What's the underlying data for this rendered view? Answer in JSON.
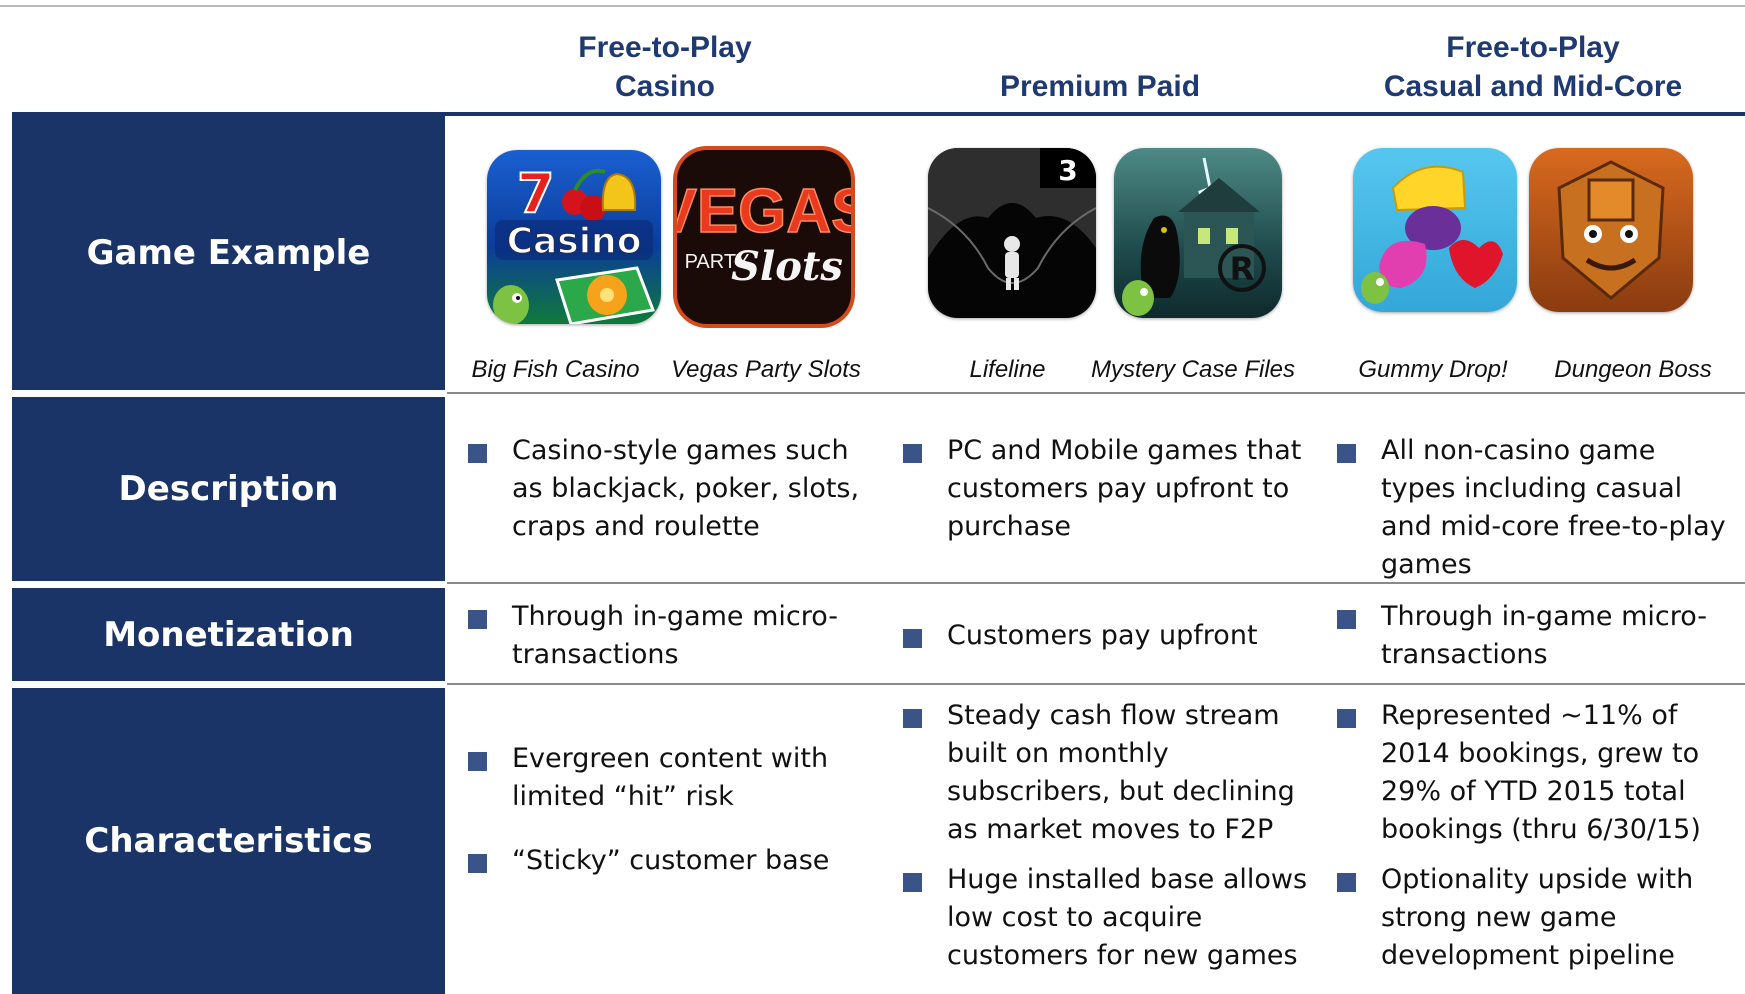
{
  "columns": [
    {
      "line1": "Free-to-Play",
      "line2": "Casino"
    },
    {
      "line1": "",
      "line2": "Premium Paid"
    },
    {
      "line1": "Free-to-Play",
      "line2": "Casual and Mid-Core"
    }
  ],
  "rows": {
    "game_example": "Game Example",
    "description": "Description",
    "monetization": "Monetization",
    "characteristics": "Characteristics"
  },
  "games": [
    {
      "name": "Big Fish Casino",
      "icon": "casino-icon",
      "icon_text": "Casino"
    },
    {
      "name": "Vegas Party Slots",
      "icon": "slots-icon",
      "icon_text_1": "VEGAS",
      "icon_text_2": "PARTY",
      "icon_text_3": "Slots"
    },
    {
      "name": "Lifeline",
      "icon": "astronaut-icon",
      "icon_badge": "3"
    },
    {
      "name": "Mystery Case Files",
      "icon": "haunted-house-icon",
      "icon_badge": "R"
    },
    {
      "name": "Gummy Drop!",
      "icon": "gummy-candy-icon"
    },
    {
      "name": "Dungeon Boss",
      "icon": "dungeon-warrior-icon"
    }
  ],
  "description": [
    [
      "Casino-style games such as blackjack, poker, slots, craps and roulette"
    ],
    [
      "PC and Mobile games that customers pay upfront to purchase"
    ],
    [
      "All non-casino game types including casual and mid-core free-to-play games"
    ]
  ],
  "monetization": [
    [
      "Through in-game micro-transactions"
    ],
    [
      "Customers pay upfront"
    ],
    [
      "Through in-game micro-transactions"
    ]
  ],
  "characteristics": [
    [
      "Evergreen content with limited “hit” risk",
      "“Sticky” customer base"
    ],
    [
      "Steady cash flow stream built on monthly subscribers, but declining as market moves to F2P",
      "Huge installed base allows low cost to acquire customers for new games"
    ],
    [
      "Represented ~11% of 2014 bookings,  grew to 29% of YTD 2015 total bookings (thru 6/30/15)",
      "Optionality upside with strong new game development pipeline"
    ]
  ],
  "colors": {
    "navy": "#1b3467",
    "heading": "#1f3a73",
    "bullet": "#3a5488"
  }
}
